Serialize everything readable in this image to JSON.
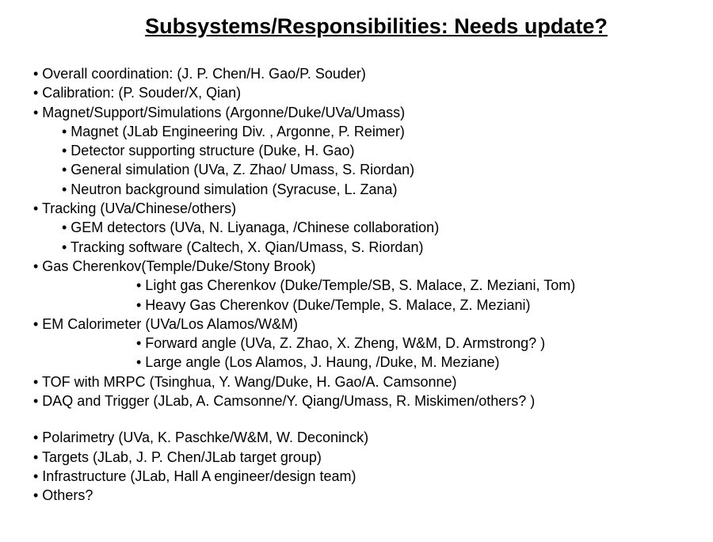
{
  "title": "Subsystems/Responsibilities: Needs update?",
  "lines": {
    "l0": "• Overall coordination: (J. P. Chen/H. Gao/P. Souder)",
    "l1": "• Calibration: (P. Souder/X, Qian)",
    "l2": "• Magnet/Support/Simulations (Argonne/Duke/UVa/Umass)",
    "l3": "• Magnet   (JLab Engineering Div. , Argonne, P. Reimer)",
    "l4": "• Detector supporting structure   (Duke, H. Gao)",
    "l5": "• General simulation (UVa, Z. Zhao/ Umass, S. Riordan)",
    "l6": "• Neutron background simulation (Syracuse, L. Zana)",
    "l7": "• Tracking (UVa/Chinese/others)",
    "l8": "• GEM detectors  (UVa, N. Liyanaga, /Chinese collaboration)",
    "l9": "• Tracking software (Caltech, X. Qian/Umass, S. Riordan)",
    "l10": "• Gas Cherenkov(Temple/Duke/Stony Brook)",
    "l11": "• Light gas Cherenkov (Duke/Temple/SB, S. Malace, Z. Meziani, Tom)",
    "l12": "• Heavy Gas Cherenkov (Duke/Temple, S. Malace, Z. Meziani)",
    "l13": "• EM Calorimeter (UVa/Los Alamos/W&M)",
    "l14": "• Forward angle (UVa, Z. Zhao, X. Zheng, W&M, D. Armstrong? )",
    "l15": "• Large angle (Los Alamos, J. Haung, /Duke, M. Meziane)",
    "l16": "• TOF with MRPC (Tsinghua, Y.  Wang/Duke, H. Gao/A. Camsonne)",
    "l17": "• DAQ and Trigger (JLab, A. Camsonne/Y. Qiang/Umass, R. Miskimen/others? )",
    "l18": "• Polarimetry (UVa, K. Paschke/W&M, W. Deconinck)",
    "l19": "• Targets (JLab, J. P. Chen/JLab target group)",
    "l20": "• Infrastructure (JLab, Hall A engineer/design team)",
    "l21": "• Others?"
  }
}
